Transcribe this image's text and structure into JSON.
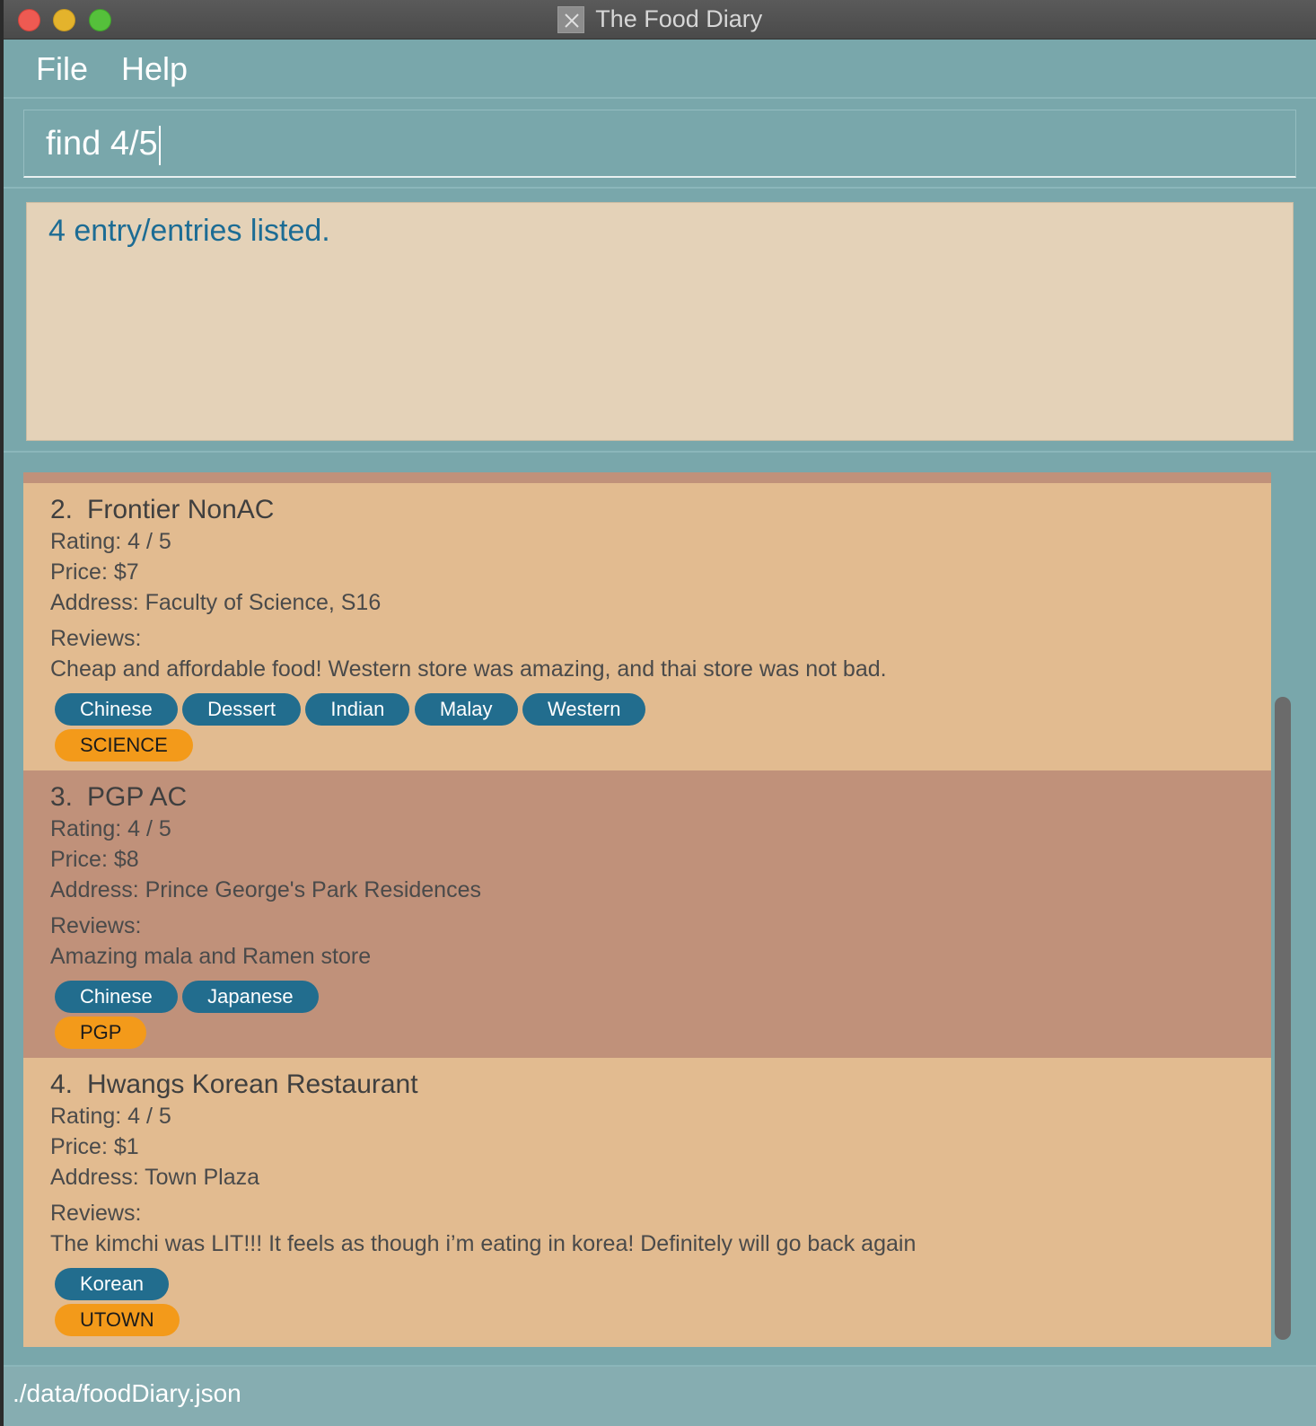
{
  "window": {
    "title": "The Food Diary"
  },
  "menu": {
    "file": "File",
    "help": "Help"
  },
  "command": {
    "value": "find 4/5"
  },
  "result": {
    "message": "4 entry/entries listed."
  },
  "entries": [
    {
      "index": "2.",
      "name": "Frontier NonAC",
      "rating": "Rating: 4 / 5",
      "price": "Price: $7",
      "address": "Address: Faculty of Science, S16",
      "reviews_label": "Reviews:",
      "review": "Cheap and affordable food! Western store was amazing, and thai store was not bad.",
      "categories": [
        "Chinese",
        "Dessert",
        "Indian",
        "Malay",
        "Western"
      ],
      "school": "SCIENCE"
    },
    {
      "index": "3.",
      "name": "PGP AC",
      "rating": "Rating: 4 / 5",
      "price": "Price: $8",
      "address": "Address: Prince George's Park Residences",
      "reviews_label": "Reviews:",
      "review": "Amazing mala and Ramen store",
      "categories": [
        "Chinese",
        "Japanese"
      ],
      "school": "PGP"
    },
    {
      "index": "4.",
      "name": "Hwangs Korean Restaurant",
      "rating": "Rating: 4 / 5",
      "price": "Price: $1",
      "address": "Address: Town Plaza",
      "reviews_label": "Reviews:",
      "review": "The kimchi was LIT!!! It feels as though i’m eating in korea! Definitely will go back again",
      "categories": [
        "Korean"
      ],
      "school": "UTOWN"
    }
  ],
  "status": {
    "path": "./data/foodDiary.json"
  },
  "colors": {
    "background": "#79a7ab",
    "result_bg": "#e4d2b8",
    "result_text": "#1c6c94",
    "card_odd": "#e2bb90",
    "card_even": "#c0917a",
    "category_tag": "#226d8e",
    "school_tag": "#f39a1a"
  },
  "icons": {
    "app": "fork-knife-icon"
  }
}
